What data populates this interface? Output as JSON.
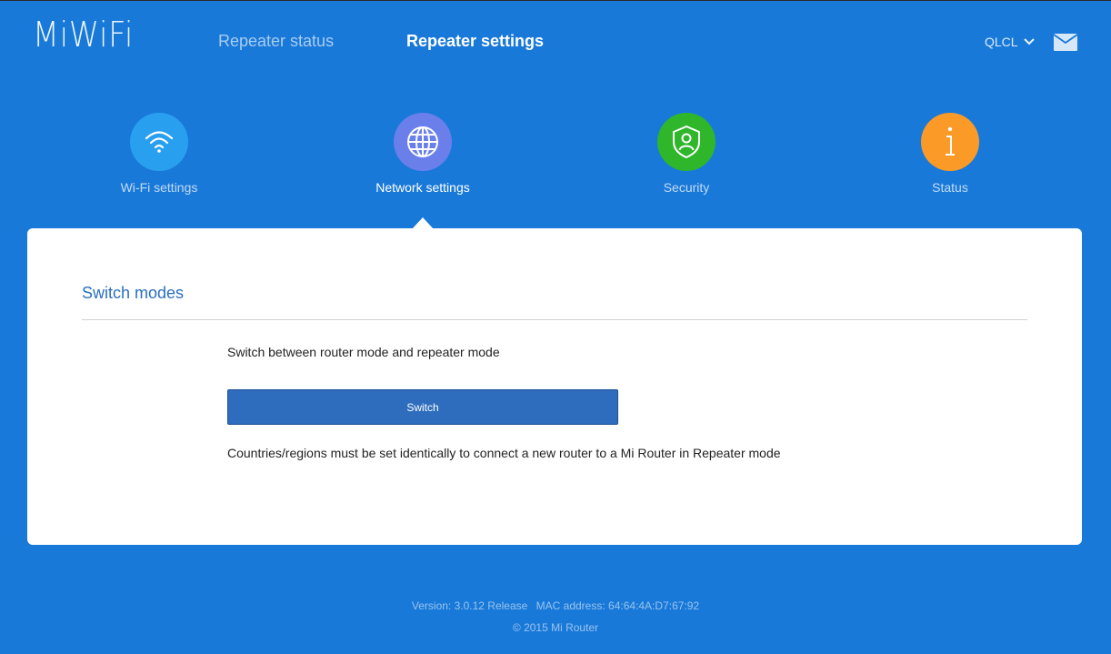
{
  "header": {
    "logo": "MiWiFi",
    "nav": {
      "status": "Repeater status",
      "settings": "Repeater settings"
    },
    "user": "QLCL"
  },
  "categories": [
    {
      "label": "Wi-Fi settings",
      "icon": "wifi-icon",
      "color": "#29a0ef"
    },
    {
      "label": "Network settings",
      "icon": "globe-icon",
      "color": "#6a7fea"
    },
    {
      "label": "Security",
      "icon": "shield-user-icon",
      "color": "#2fb62b"
    },
    {
      "label": "Status",
      "icon": "info-icon",
      "color": "#fb9a26"
    }
  ],
  "panel": {
    "title": "Switch modes",
    "description": "Switch between router mode and repeater mode",
    "button": "Switch",
    "note": "Countries/regions must be set identically to connect a new router to a Mi Router in Repeater mode"
  },
  "footer": {
    "version": "Version: 3.0.12 Release",
    "mac": "MAC address: 64:64:4A:D7:67:92",
    "copyright": "© 2015 Mi Router"
  },
  "colors": {
    "background": "#1979d9",
    "accent": "#2a6fbf",
    "button": "#2e6dbd"
  }
}
